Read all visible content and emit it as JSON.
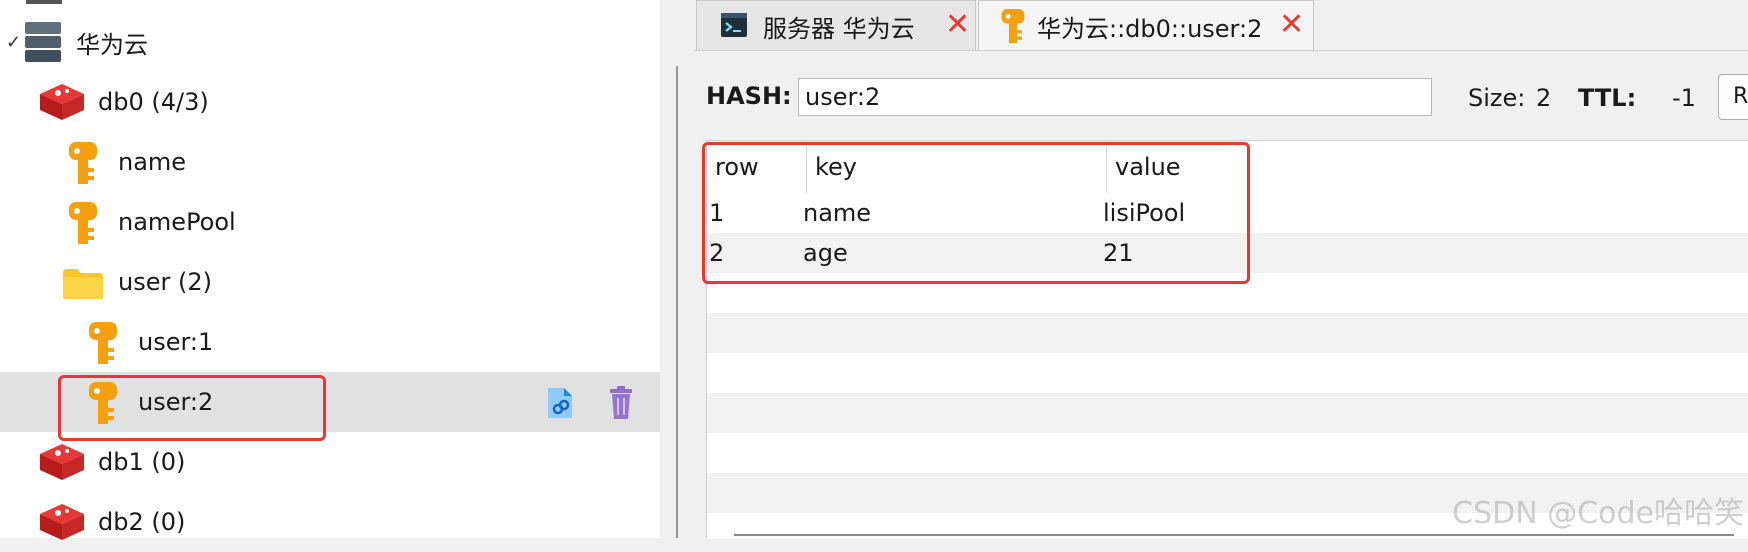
{
  "tree": {
    "server": {
      "label": "华为云"
    },
    "db0": {
      "label": "db0  (4/3)"
    },
    "keys": [
      {
        "label": "name"
      },
      {
        "label": "namePool"
      }
    ],
    "folder": {
      "label": "user (2)"
    },
    "folder_keys": [
      {
        "label": "user:1"
      },
      {
        "label": "user:2"
      }
    ],
    "db1": {
      "label": "db1 (0)"
    },
    "db2": {
      "label": "db2 (0)"
    }
  },
  "tabs": [
    {
      "label": "服务器 华为云"
    },
    {
      "label": "华为云::db0::user:2"
    }
  ],
  "hash": {
    "label": "HASH:",
    "value": "user:2",
    "size_label": "Size:",
    "size_value": "2",
    "ttl_label": "TTL:",
    "ttl_value": "-1",
    "button_label": "R"
  },
  "table": {
    "columns": [
      "row",
      "key",
      "value"
    ],
    "rows": [
      {
        "row": "1",
        "key": "name",
        "value": "lisiPool"
      },
      {
        "row": "2",
        "key": "age",
        "value": "21"
      }
    ]
  },
  "watermark": "CSDN @Code哈哈笑",
  "colors": {
    "highlight": "#e53935",
    "key_icon": "#f6a010",
    "redis_icon": "#d32f2f",
    "folder_icon": "#f9c623"
  }
}
